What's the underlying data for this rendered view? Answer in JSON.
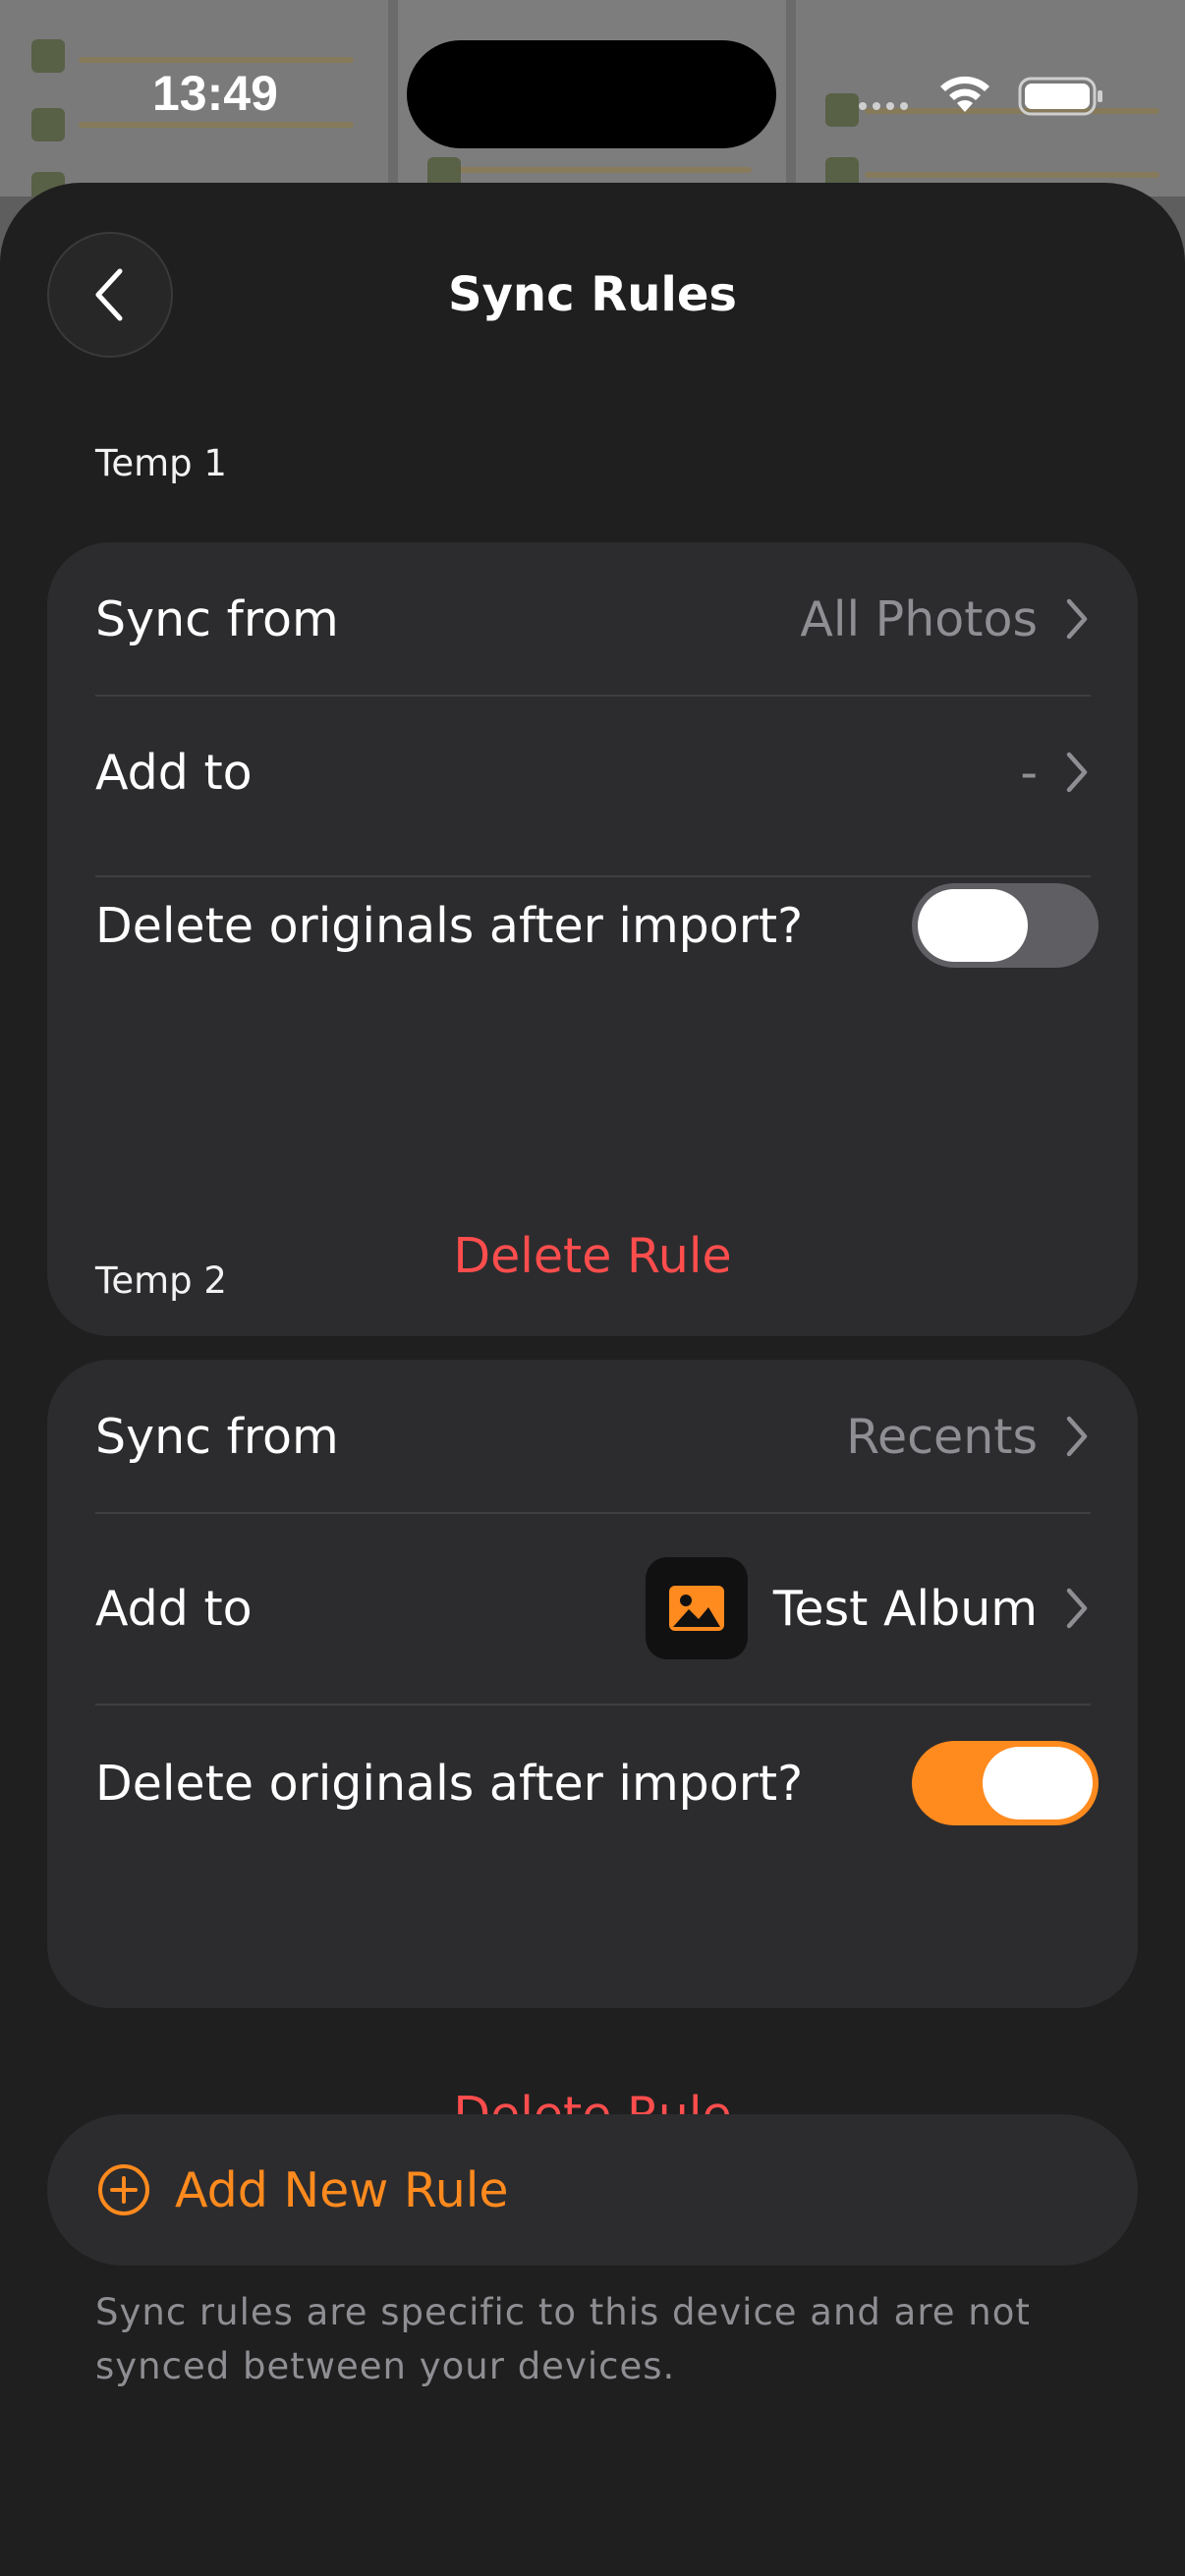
{
  "status_bar": {
    "time": "13:49"
  },
  "header": {
    "title": "Sync Rules"
  },
  "rules": [
    {
      "name": "Temp 1",
      "sync_from_label": "Sync from",
      "sync_from_value": "All Photos",
      "add_to_label": "Add to",
      "add_to_value": "-",
      "delete_originals_label": "Delete originals after import?",
      "delete_originals_on": false,
      "delete_label": "Delete Rule"
    },
    {
      "name": "Temp 2",
      "sync_from_label": "Sync from",
      "sync_from_value": "Recents",
      "add_to_label": "Add to",
      "add_to_value": "Test Album",
      "delete_originals_label": "Delete originals after import?",
      "delete_originals_on": true,
      "delete_label": "Delete Rule"
    }
  ],
  "add_rule": {
    "label": "Add New Rule"
  },
  "footnote": "Sync rules are specific to this device and are not synced between your devices.",
  "colors": {
    "accent": "#ff8a1e",
    "destructive": "#ff4d4d",
    "toggle_off": "#5f5f63",
    "toggle_on": "#ff8a1e",
    "sheet_bg": "#1f1f1f",
    "card_bg": "#2c2c2e"
  },
  "icons": [
    "chevron-left-icon",
    "chevron-right-icon",
    "photo-icon",
    "plus-circle-icon",
    "wifi-icon",
    "battery-icon",
    "cellular-icon"
  ]
}
